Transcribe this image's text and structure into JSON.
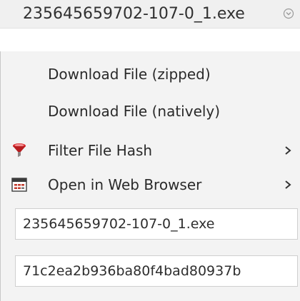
{
  "header": {
    "title": "235645659702-107-0_1.exe"
  },
  "menu": {
    "items": [
      {
        "label": "Download File (zipped)"
      },
      {
        "label": "Download File (natively)"
      },
      {
        "label": "Filter File Hash",
        "icon": "funnel-icon"
      },
      {
        "label": "Open in Web Browser",
        "icon": "web-browser-icon"
      }
    ],
    "fields": [
      {
        "value": "235645659702-107-0_1.exe"
      },
      {
        "value": "71c2ea2b936ba80f4bad80937b"
      }
    ]
  },
  "colors": {
    "header_bg": "#f0f0f0",
    "menu_bg": "#f3f3f3",
    "funnel_red": "#d9262b",
    "browser_red": "#c0392b"
  }
}
